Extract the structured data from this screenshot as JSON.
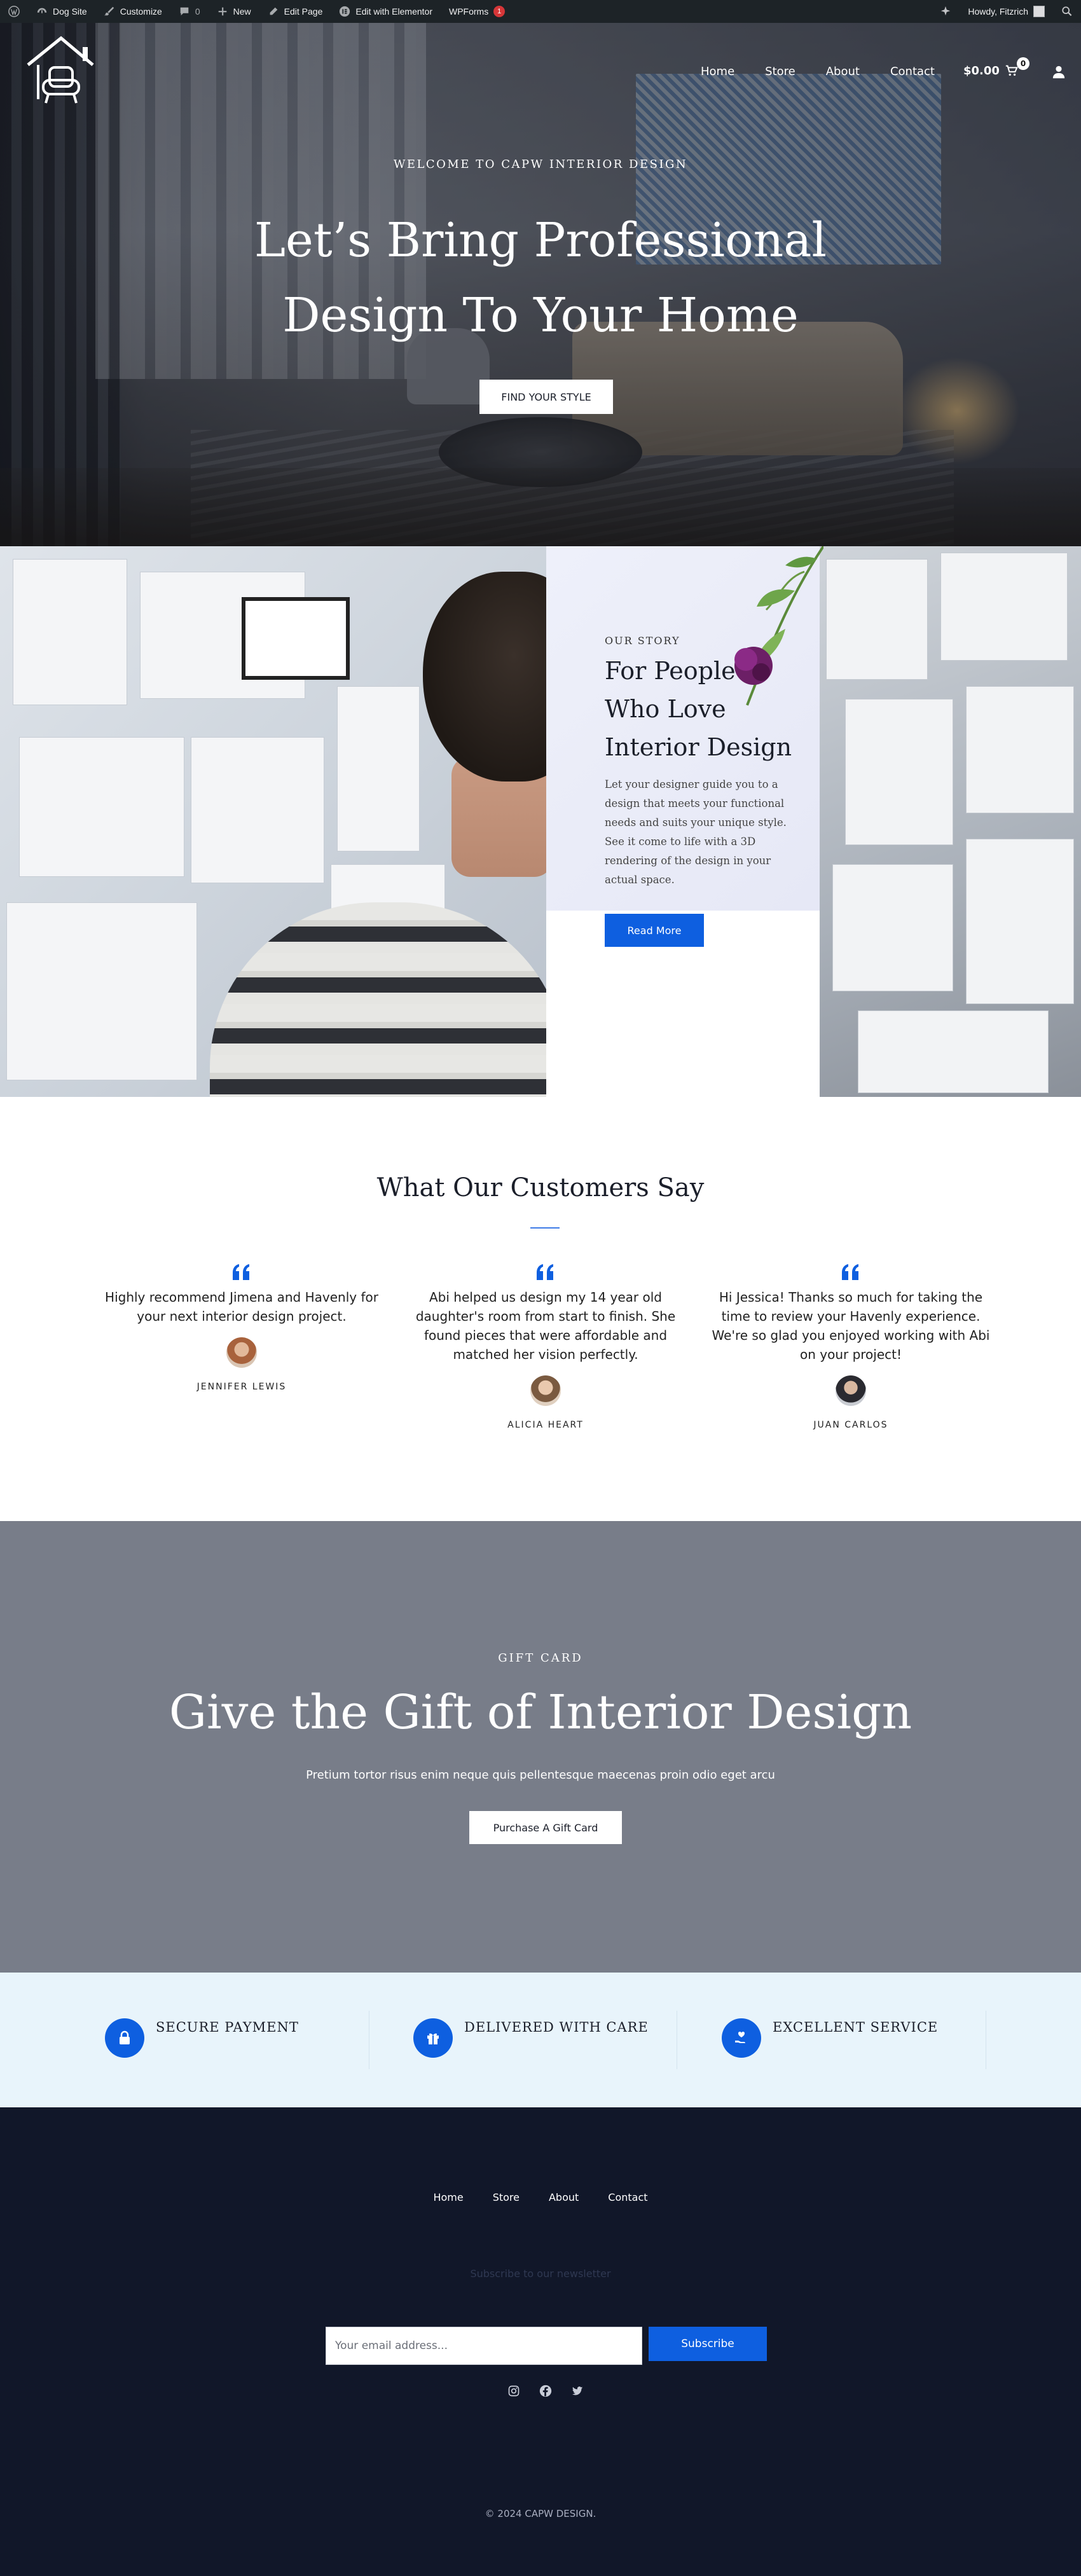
{
  "admin_bar": {
    "site_name": "Dog Site",
    "customize": "Customize",
    "comments_count": "0",
    "new": "New",
    "edit_page": "Edit Page",
    "edit_elementor": "Edit with Elementor",
    "wpforms": "WPForms",
    "wpforms_badge": "1",
    "howdy": "Howdy, Fitzrich"
  },
  "header": {
    "nav": [
      "Home",
      "Store",
      "About",
      "Contact"
    ],
    "cart_total": "$0.00",
    "cart_count": "0",
    "logo_icon": "house-armchair-logo",
    "cart_icon": "cart-icon",
    "account_icon": "user-icon"
  },
  "hero": {
    "kicker": "WELCOME TO CAPW INTERIOR DESIGN",
    "title_line1": "Let’s Bring Professional",
    "title_line2": "Design To Your Home",
    "button": "FIND YOUR STYLE"
  },
  "story": {
    "kicker": "OUR STORY",
    "title": "For People Who Love Interior Design",
    "body": "Let your designer guide you to a design that meets your functional needs and suits your unique style. See it come to life with a 3D rendering of the design in your actual space.",
    "button": "Read More"
  },
  "testimonials": {
    "title": "What Our Customers Say",
    "accent_color": "#0e5fe0",
    "items": [
      {
        "text": "Highly recommend Jimena and Havenly for your next interior design project.",
        "name": "JENNIFER LEWIS"
      },
      {
        "text": "Abi helped us design my 14 year old daughter's room from start to finish. She found pieces that were affordable and matched her vision perfectly.",
        "name": "ALICIA HEART"
      },
      {
        "text": "Hi Jessica! Thanks so much for taking the time to review your Havenly experience. We're so glad you enjoyed working with Abi on your project!",
        "name": "JUAN CARLOS"
      }
    ]
  },
  "gift_card": {
    "kicker": "GIFT CARD",
    "title": "Give the Gift of Interior Design",
    "subtitle": "Pretium tortor risus enim neque quis pellentesque maecenas proin odio eget arcu",
    "button": "Purchase A Gift Card"
  },
  "features": [
    {
      "label": "SECURE PAYMENT",
      "icon": "lock-icon"
    },
    {
      "label": "DELIVERED WITH CARE",
      "icon": "gift-box-icon"
    },
    {
      "label": "EXCELLENT SERVICE",
      "icon": "hand-heart-icon"
    }
  ],
  "footer": {
    "nav": [
      "Home",
      "Store",
      "About",
      "Contact"
    ],
    "newsletter_label": "Subscribe to our newsletter",
    "email_placeholder": "Your email address...",
    "subscribe": "Subscribe",
    "social": [
      "instagram-icon",
      "facebook-icon",
      "twitter-icon"
    ],
    "copyright": "© 2024 CAPW DESIGN."
  },
  "colors": {
    "primary_blue": "#0e5fe0",
    "gift_bg": "#787d89",
    "features_bg": "#e8f4fb",
    "footer_bg": "#111729",
    "admin_bar_bg": "#1d2327"
  }
}
